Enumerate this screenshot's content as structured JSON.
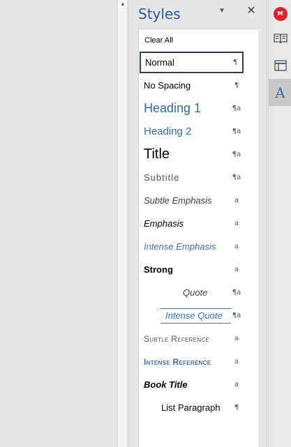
{
  "pane": {
    "title": "Styles",
    "menu_glyph": "▼",
    "close_glyph": "✕",
    "clear_all": "Clear All"
  },
  "styles": [
    {
      "name": "Normal",
      "mark": "¶",
      "mark_kind": "paragraph",
      "selected": true
    },
    {
      "name": "No Spacing",
      "mark": "¶",
      "mark_kind": "paragraph"
    },
    {
      "name": "Heading 1",
      "mark": "¶a",
      "mark_kind": "linked"
    },
    {
      "name": "Heading 2",
      "mark": "¶a",
      "mark_kind": "linked"
    },
    {
      "name": "Title",
      "mark": "¶a",
      "mark_kind": "linked"
    },
    {
      "name": "Subtitle",
      "mark": "¶a",
      "mark_kind": "linked"
    },
    {
      "name": "Subtle Emphasis",
      "mark": "a",
      "mark_kind": "character"
    },
    {
      "name": "Emphasis",
      "mark": "a",
      "mark_kind": "character"
    },
    {
      "name": "Intense Emphasis",
      "mark": "a",
      "mark_kind": "character"
    },
    {
      "name": "Strong",
      "mark": "a",
      "mark_kind": "character"
    },
    {
      "name": "Quote",
      "mark": "¶a",
      "mark_kind": "linked"
    },
    {
      "name": "Intense Quote",
      "mark": "¶a",
      "mark_kind": "linked"
    },
    {
      "name": "Subtle Reference",
      "mark": "a",
      "mark_kind": "character"
    },
    {
      "name": "Intense Reference",
      "mark": "a",
      "mark_kind": "character"
    },
    {
      "name": "Book Title",
      "mark": "a",
      "mark_kind": "character"
    },
    {
      "name": "List Paragraph",
      "mark": "¶",
      "mark_kind": "paragraph"
    }
  ],
  "rail": {
    "logo_text": "M",
    "styles_glyph": "A",
    "icons": [
      "mindmap-logo-icon",
      "book-icon",
      "layout-panel-icon",
      "styles-pane-icon"
    ]
  },
  "colors": {
    "accent_blue": "#2b579a",
    "heading_blue": "#2e6ab0",
    "logo_red": "#e0232b"
  }
}
